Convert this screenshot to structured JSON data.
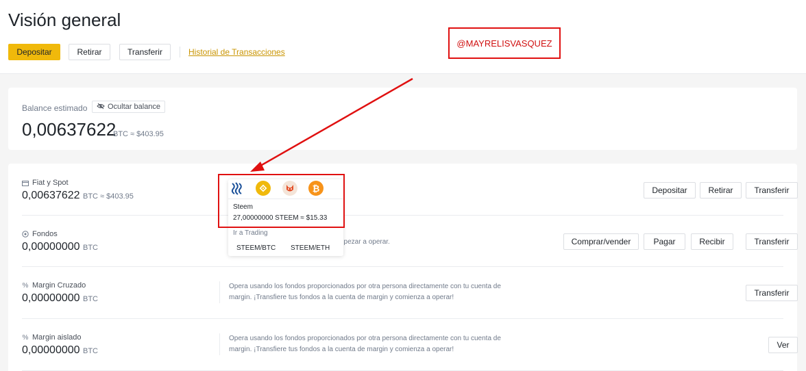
{
  "header": {
    "title": "Visión general",
    "buttons": {
      "deposit": "Depositar",
      "withdraw": "Retirar",
      "transfer": "Transferir"
    },
    "history_link": "Historial de Transacciones"
  },
  "annotation": {
    "user_tag": "@MAYRELISVASQUEZ"
  },
  "balance": {
    "label": "Balance estimado",
    "hide_button": "Ocultar balance",
    "value": "0,00637622",
    "sub": "BTC ≈ $403.95"
  },
  "accounts": [
    {
      "title": "Fiat y Spot",
      "value": "0,00637622",
      "unit": "BTC ≈ $403.95",
      "buttons": [
        "Depositar",
        "Retirar",
        "Transferir"
      ]
    },
    {
      "title": "Fondos",
      "value": "0,00000000",
      "unit": "BTC",
      "desc_partial": "ra empezar a operar.",
      "buttons": [
        "Comprar/vender",
        "Pagar",
        "Recibir",
        "Transferir"
      ]
    },
    {
      "title": "Margin Cruzado",
      "value": "0,00000000",
      "unit": "BTC",
      "desc_line1": "Opera usando los fondos proporcionados por otra persona directamente con tu cuenta de",
      "desc_line2": "margin. ¡Transfiere tus fondos a la cuenta de margin y comienza a operar!",
      "buttons": [
        "Transferir"
      ]
    },
    {
      "title": "Margin aislado",
      "value": "0,00000000",
      "unit": "BTC",
      "desc_line1": "Opera usando los fondos proporcionados por otra persona directamente con tu cuenta de",
      "desc_line2": "margin. ¡Transfiere tus fondos a la cuenta de margin y comienza a operar!",
      "buttons": [
        "Ver"
      ]
    }
  ],
  "popup": {
    "coins": [
      "steem-icon",
      "bnb-icon",
      "shiba-icon",
      "bitcoin-icon"
    ],
    "coin_name": "Steem",
    "coin_amount": "27,00000000 STEEM ≈ $15.33",
    "trade_label": "Ir a Trading",
    "pairs": [
      "STEEM/BTC",
      "STEEM/ETH"
    ]
  },
  "colors": {
    "accent": "#f0b90b",
    "annotation_red": "#e01010",
    "link": "#c99400"
  }
}
